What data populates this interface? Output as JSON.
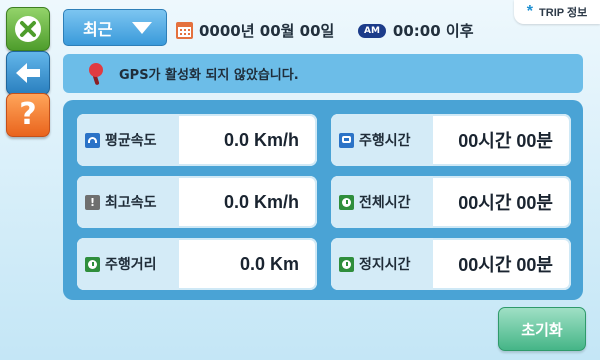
{
  "sidebar": {
    "close_icon": "close-icon",
    "back_icon": "back-arrow-icon",
    "help_icon": "help-icon",
    "help_glyph": "?"
  },
  "trip_tab": {
    "label": "TRIP 정보",
    "icon": "asterisk-icon"
  },
  "header": {
    "period_select": "최근",
    "date": "0000년 00월 00일",
    "ampm": "AM",
    "time_suffix": "00:00 이후"
  },
  "gps": {
    "message": "GPS가 활성화 되지 않았습니다."
  },
  "stats": [
    {
      "label": "평균속도",
      "value": "0.0 Km/h",
      "icon": "speed-icon"
    },
    {
      "label": "주행시간",
      "value": "00시간 00분",
      "icon": "bus-icon"
    },
    {
      "label": "최고속도",
      "value": "0.0 Km/h",
      "icon": "warning-icon"
    },
    {
      "label": "전체시간",
      "value": "00시간 00분",
      "icon": "clock-icon"
    },
    {
      "label": "주행거리",
      "value": "0.0 Km",
      "icon": "clock-icon"
    },
    {
      "label": "정지시간",
      "value": "00시간 00분",
      "icon": "clock-icon"
    }
  ],
  "reset_button": "초기화",
  "colors": {
    "panel": "#4aa3d5",
    "banner": "#6cbde8",
    "reset": "#45b587",
    "close": "#4e9d2c",
    "back": "#2a7fbe",
    "help": "#e9641d"
  }
}
